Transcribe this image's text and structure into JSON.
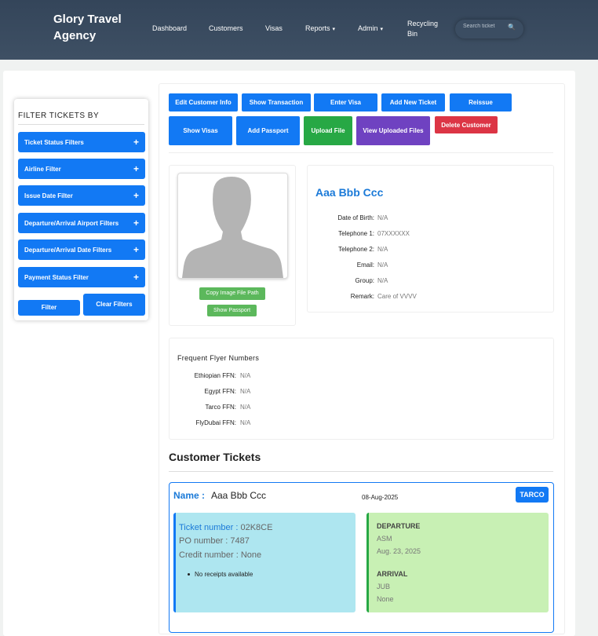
{
  "nav": {
    "brand": "Glory Travel Agency",
    "links": [
      "Dashboard",
      "Customers",
      "Visas",
      "Reports",
      "Admin",
      "Recycling Bin"
    ],
    "caret": "▾",
    "search_placeholder": "Search ticket",
    "search_icon": "search-icon"
  },
  "filters": {
    "title": "FILTER TICKETS BY",
    "items": [
      "Ticket Status Filters",
      "Airline Filter",
      "Issue Date Filter",
      "Departure/Arrival Airport Filters",
      "Departure/Arrival Date Filters",
      "Payment Status Filter"
    ],
    "plus": "+",
    "filter_label": "Filter",
    "clear_label": "Clear Filters"
  },
  "actions": {
    "edit_customer": "Edit Customer Info",
    "show_transaction": "Show Transaction",
    "enter_visa": "Enter Visa",
    "add_ticket": "Add New Ticket",
    "reissue": "Reissue",
    "show_visas": "Show Visas",
    "add_passport": "Add Passport",
    "upload_file": "Upload File",
    "view_uploaded": "View Uploaded Files",
    "delete_customer": "Delete Customer"
  },
  "photo": {
    "copy_path": "Copy Image File Path",
    "show_passport": "Show Passport"
  },
  "customer": {
    "name": "Aaa Bbb Ccc",
    "fields": [
      {
        "label": "Date of Birth:",
        "value": "N/A"
      },
      {
        "label": "Telephone 1:",
        "value": "07XXXXXX"
      },
      {
        "label": "Telephone 2:",
        "value": "N/A"
      },
      {
        "label": "Email:",
        "value": "N/A"
      },
      {
        "label": "Group:",
        "value": "N/A"
      },
      {
        "label": "Remark:",
        "value": "Care of VVVV"
      }
    ]
  },
  "ffn": {
    "title": "Frequent Flyer Numbers",
    "items": [
      {
        "label": "Ethiopian FFN:",
        "value": "N/A"
      },
      {
        "label": "Egypt FFN:",
        "value": "N/A"
      },
      {
        "label": "Tarco FFN:",
        "value": "N/A"
      },
      {
        "label": "FlyDubai FFN:",
        "value": "N/A"
      }
    ]
  },
  "tickets": {
    "title": "Customer Tickets",
    "card": {
      "name_label": "Name :",
      "name_value": "Aaa Bbb Ccc",
      "date": "08-Aug-2025",
      "airline": "TARCO",
      "ticket_number_label": "Ticket number :",
      "ticket_number": "02K8CE",
      "po_number": "PO number : 7487",
      "credit_number": "Credit number : None",
      "receipts": "No receipts available",
      "departure_label": "DEPARTURE",
      "departure_airport": "ASM",
      "departure_date": "Aug. 23, 2025",
      "arrival_label": "ARRIVAL",
      "arrival_airport": "JUB",
      "arrival_date": "None"
    }
  },
  "colors": {
    "primary": "#1279f4",
    "success": "#27a845",
    "purple": "#6f42c1",
    "danger": "#dc3545",
    "nav_bg": "#3a4b5f",
    "info_bg": "#aee6f0",
    "route_bg": "#c8f0b4"
  }
}
